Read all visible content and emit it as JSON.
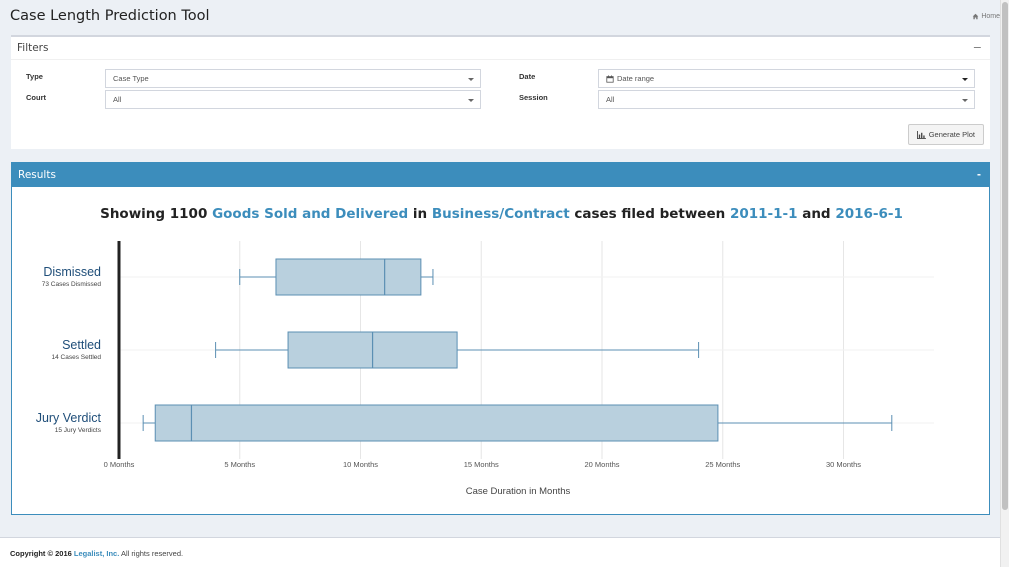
{
  "app": {
    "title": "Case Length Prediction Tool",
    "home_label": "Home"
  },
  "filters": {
    "title": "Filters",
    "collapse_symbol": "−",
    "type_label": "Type",
    "type_value": "Case Type",
    "court_label": "Court",
    "court_value": "All",
    "date_label": "Date",
    "date_value": "Date range",
    "session_label": "Session",
    "session_value": "All",
    "generate_label": "Generate Plot"
  },
  "results": {
    "title": "Results",
    "collapse_symbol": "-",
    "headline": {
      "p1": "Showing 1100 ",
      "case_type": "Goods Sold and Delivered",
      "p2": " in ",
      "category": "Business/Contract",
      "p3": " cases filed between ",
      "start": "2011-1-1",
      "p4": " and ",
      "end": "2016-6-1"
    }
  },
  "chart_data": {
    "type": "boxplot",
    "orientation": "horizontal",
    "xlabel": "Case Duration in Months",
    "xlim": [
      0,
      33
    ],
    "xticks": [
      0,
      5,
      10,
      15,
      20,
      25,
      30
    ],
    "xtick_labels": [
      "0 Months",
      "5 Months",
      "10 Months",
      "15 Months",
      "20 Months",
      "25 Months",
      "30 Months"
    ],
    "grid": true,
    "box_color": "#b9d0de",
    "line_color": "#5b8fb3",
    "series": [
      {
        "name": "Dismissed",
        "sublabel": "73 Cases Dismissed",
        "min": 5,
        "q1": 6.5,
        "median": 11,
        "q3": 12.5,
        "max": 13
      },
      {
        "name": "Settled",
        "sublabel": "14 Cases Settled",
        "min": 4,
        "q1": 7,
        "median": 10.5,
        "q3": 14,
        "max": 24
      },
      {
        "name": "Jury Verdict",
        "sublabel": "15 Jury Verdicts",
        "min": 1,
        "q1": 1.5,
        "median": 3,
        "q3": 24.8,
        "max": 32
      }
    ]
  },
  "footer": {
    "copyright": "Copyright © 2016 ",
    "company": "Legalist, Inc.",
    "rights": " All rights reserved."
  }
}
